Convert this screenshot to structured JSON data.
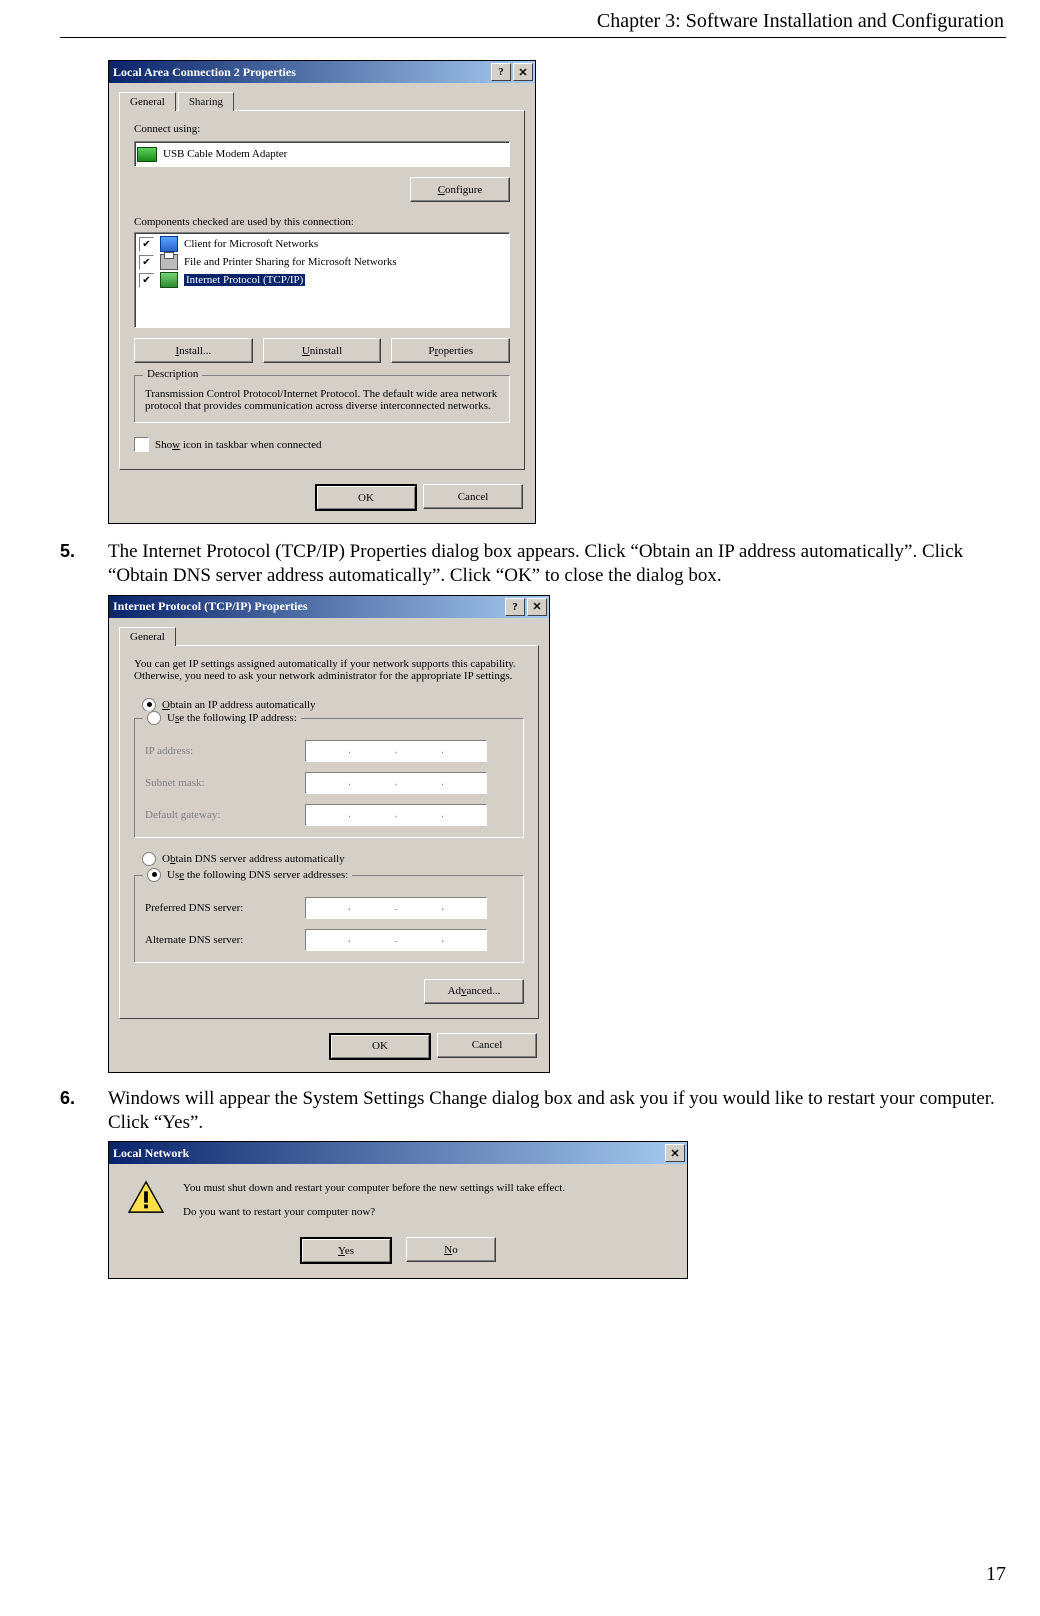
{
  "header": {
    "running_head": "Chapter 3: Software Installation and Configuration"
  },
  "page_number": "17",
  "steps": {
    "s5": {
      "num": "5.",
      "text": "The Internet Protocol (TCP/IP) Properties dialog box appears. Click “Obtain an IP address automatically”. Click “Obtain DNS server address automatically”. Click “OK” to close the dialog box."
    },
    "s6": {
      "num": "6.",
      "text": "Windows will appear the System Settings Change dialog box and ask you if you would like to restart your computer. Click “Yes”."
    }
  },
  "dlg1": {
    "title": "Local Area Connection 2 Properties",
    "tab_general": "General",
    "tab_sharing": "Sharing",
    "connect_using_lbl": "Connect using:",
    "adapter": "USB Cable Modem Adapter",
    "configure_btn": "Configure",
    "components_lbl": "Components checked are used by this connection:",
    "comp1": "Client for Microsoft Networks",
    "comp2": "File and Printer Sharing for Microsoft Networks",
    "comp3": "Internet Protocol (TCP/IP)",
    "install_btn": "Install...",
    "uninstall_btn": "Uninstall",
    "properties_btn": "Properties",
    "desc_legend": "Description",
    "desc_text": "Transmission Control Protocol/Internet Protocol. The default wide area network protocol that provides communication across diverse interconnected networks.",
    "show_icon": "Show icon in taskbar when connected",
    "ok": "OK",
    "cancel": "Cancel",
    "help": "?",
    "close": "✕"
  },
  "dlg2": {
    "title": "Internet Protocol (TCP/IP) Properties",
    "tab_general": "General",
    "intro": "You can get IP settings assigned automatically if your network supports this capability. Otherwise, you need to ask your network administrator for the appropriate IP settings.",
    "r_auto_ip": "Obtain an IP address automatically",
    "r_manual_ip": "Use the following IP address:",
    "ip_lbl": "IP address:",
    "mask_lbl": "Subnet mask:",
    "gw_lbl": "Default gateway:",
    "r_auto_dns": "Obtain DNS server address automatically",
    "r_manual_dns": "Use the following DNS server addresses:",
    "pdns_lbl": "Preferred DNS server:",
    "adns_lbl": "Alternate DNS server:",
    "advanced_btn": "Advanced...",
    "ok": "OK",
    "cancel": "Cancel",
    "help": "?",
    "close": "✕"
  },
  "dlg3": {
    "title": "Local Network",
    "line1": "You must shut down and restart your computer before the new settings will take effect.",
    "line2": "Do you want to restart your computer now?",
    "yes": "Yes",
    "no": "No",
    "close": "✕"
  }
}
